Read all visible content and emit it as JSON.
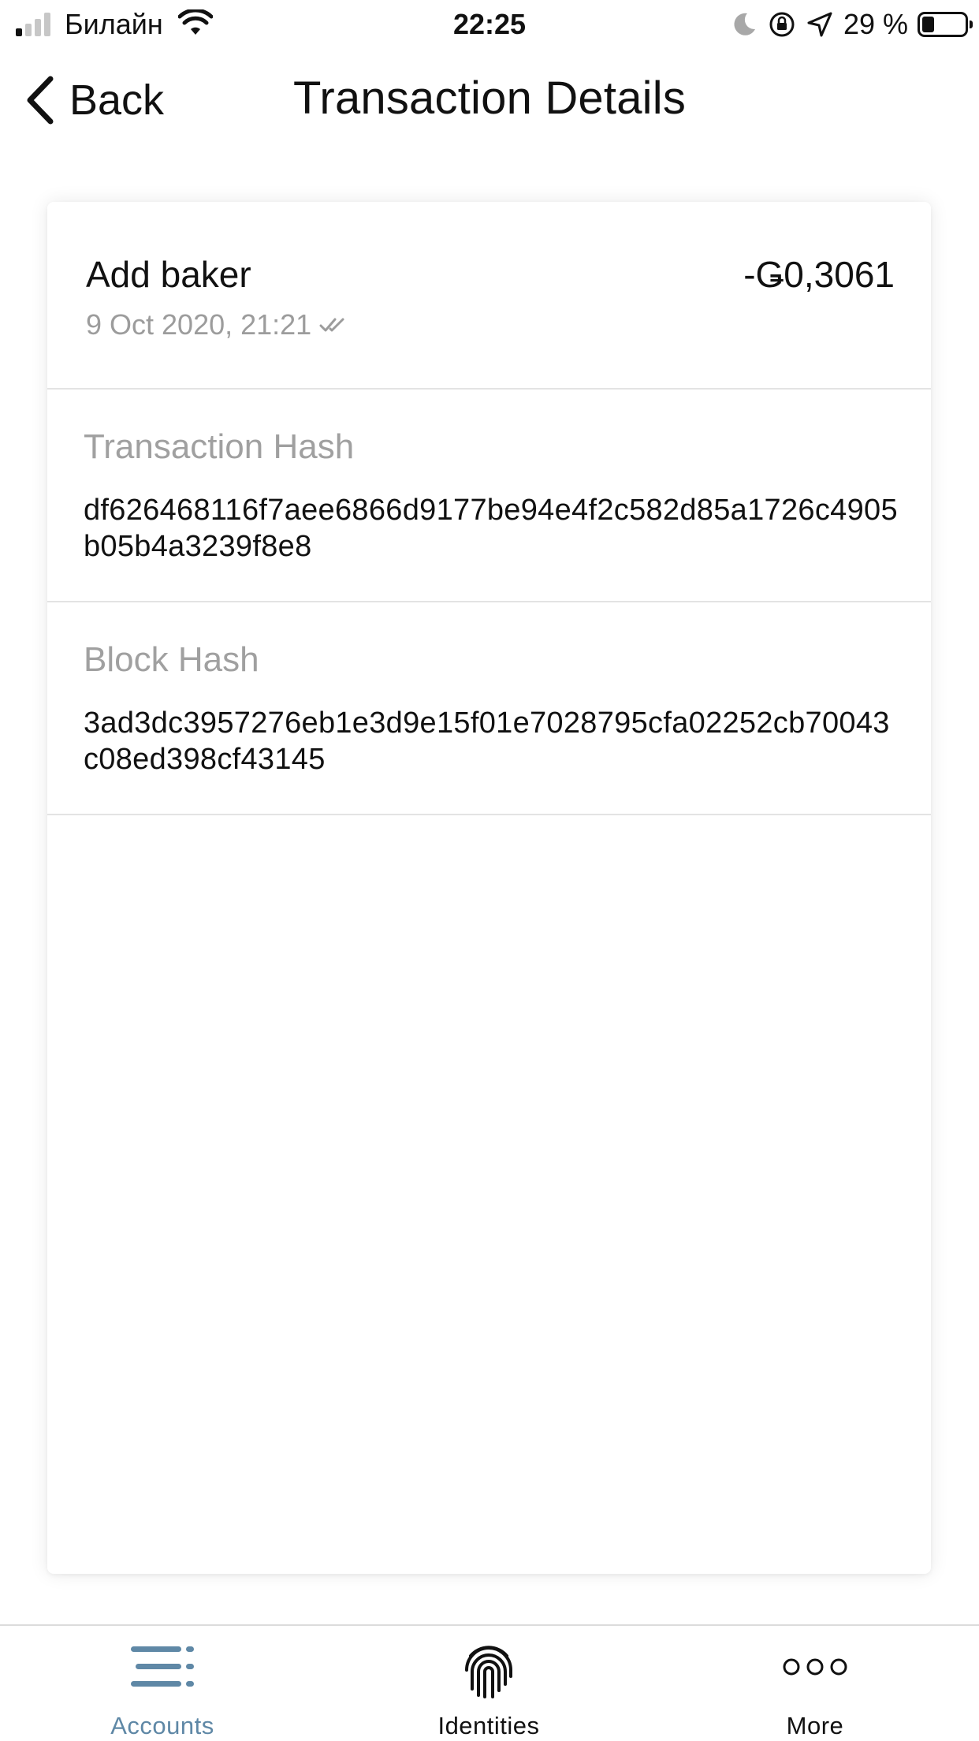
{
  "status_bar": {
    "carrier": "Билайн",
    "time": "22:25",
    "battery_percent": "29 %",
    "battery_level": 0.29,
    "icons": [
      "signal-icon",
      "wifi-icon",
      "moon-icon",
      "rotation-lock-icon",
      "location-arrow-icon",
      "battery-icon"
    ]
  },
  "nav": {
    "back_label": "Back",
    "title": "Transaction Details"
  },
  "transaction": {
    "type": "Add baker",
    "amount": "-Ǥ0,3061",
    "date": "9 Oct 2020, 21:21",
    "status_icon": "double-check-icon"
  },
  "details": {
    "transaction_hash_label": "Transaction Hash",
    "transaction_hash_value": "df626468116f7aee6866d9177be94e4f2c582d85a1726c4905b05b4a3239f8e8",
    "block_hash_label": "Block Hash",
    "block_hash_value": "3ad3dc3957276eb1e3d9e15f01e7028795cfa02252cb70043c08ed398cf43145"
  },
  "tab_bar": {
    "tabs": [
      {
        "label": "Accounts",
        "icon": "accounts-list-icon",
        "active": true
      },
      {
        "label": "Identities",
        "icon": "fingerprint-icon",
        "active": false
      },
      {
        "label": "More",
        "icon": "more-dots-icon",
        "active": false
      }
    ]
  },
  "colors": {
    "accent": "#5f88a6",
    "muted_text": "#9c9c9c",
    "divider": "#e3e3e3"
  }
}
